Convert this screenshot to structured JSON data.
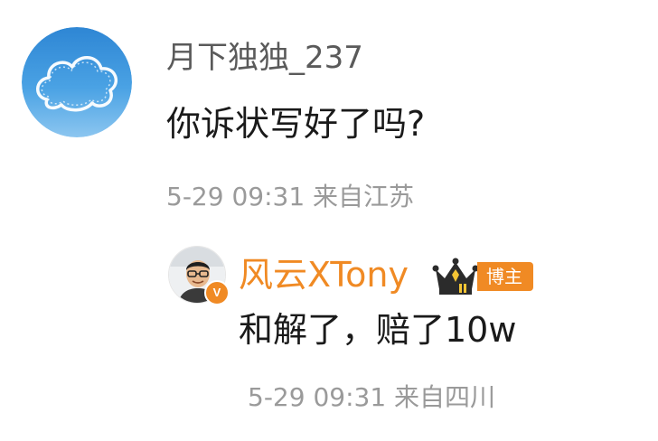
{
  "comment": {
    "avatar_icon": "cloud-avatar-icon",
    "username": "月下独独_237",
    "text": "你诉状写好了吗?",
    "meta": "5-29 09:31 来自江苏"
  },
  "reply": {
    "avatar_icon": "person-avatar-icon",
    "verified_badge": "V",
    "username": "风云XTony",
    "crown_icon": "crown-icon",
    "badge_label": "博主",
    "text": "和解了，赔了10w",
    "meta": "5-29 09:31 来自四川"
  },
  "colors": {
    "accent": "#f08a24",
    "meta_gray": "#9a9a9a",
    "text_dark": "#1a1a1a",
    "username_gray": "#5a5a5a"
  }
}
